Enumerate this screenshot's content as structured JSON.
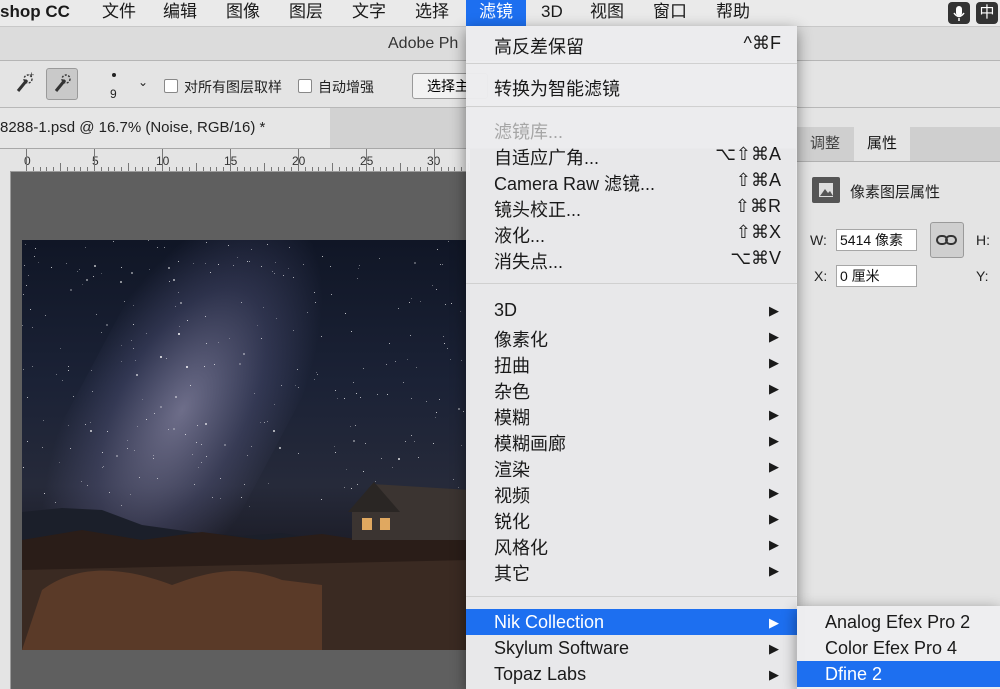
{
  "menubar": {
    "app": "shop CC",
    "items": [
      "文件",
      "编辑",
      "图像",
      "图层",
      "文字",
      "选择",
      "滤镜",
      "3D",
      "视图",
      "窗口",
      "帮助"
    ],
    "active_index": 6,
    "input_method": "中"
  },
  "window": {
    "title": "Adobe Ph"
  },
  "options_bar": {
    "brush_size": "9",
    "sample_all_layers": "对所有图层取样",
    "auto_enhance": "自动增强",
    "select_subject": "选择主"
  },
  "document_tab": {
    "label": "8288-1.psd @ 16.7% (Noise, RGB/16) *"
  },
  "ruler": {
    "labels": [
      "0",
      "5",
      "10",
      "15",
      "20",
      "25",
      "30"
    ]
  },
  "panel": {
    "tabs": [
      "调整",
      "属性"
    ],
    "selected_tab": 1,
    "title": "像素图层属性",
    "w_label": "W:",
    "w_value": "5414 像素",
    "h_label": "H:",
    "x_label": "X:",
    "x_value": "0 厘米",
    "y_label": "Y:"
  },
  "filter_menu": {
    "items": [
      {
        "label": "高反差保留",
        "shortcut": "^⌘F"
      },
      {
        "label": "转换为智能滤镜",
        "shortcut": ""
      },
      {
        "label": "滤镜库...",
        "shortcut": "",
        "disabled": true
      },
      {
        "label": "自适应广角...",
        "shortcut": "⌥⇧⌘A"
      },
      {
        "label": "Camera Raw 滤镜...",
        "shortcut": "⇧⌘A"
      },
      {
        "label": "镜头校正...",
        "shortcut": "⇧⌘R"
      },
      {
        "label": "液化...",
        "shortcut": "⇧⌘X"
      },
      {
        "label": "消失点...",
        "shortcut": "⌥⌘V"
      },
      {
        "label": "3D",
        "submenu": true
      },
      {
        "label": "像素化",
        "submenu": true
      },
      {
        "label": "扭曲",
        "submenu": true
      },
      {
        "label": "杂色",
        "submenu": true
      },
      {
        "label": "模糊",
        "submenu": true
      },
      {
        "label": "模糊画廊",
        "submenu": true
      },
      {
        "label": "渲染",
        "submenu": true
      },
      {
        "label": "视频",
        "submenu": true
      },
      {
        "label": "锐化",
        "submenu": true
      },
      {
        "label": "风格化",
        "submenu": true
      },
      {
        "label": "其它",
        "submenu": true
      },
      {
        "label": "Nik Collection",
        "submenu": true,
        "highlighted": true
      },
      {
        "label": "Skylum Software",
        "submenu": true
      },
      {
        "label": "Topaz Labs",
        "submenu": true
      }
    ]
  },
  "nik_submenu": {
    "items": [
      "Analog Efex Pro 2",
      "Color Efex Pro 4",
      "Dfine 2"
    ],
    "highlighted_index": 2
  },
  "colors": {
    "accent": "#1d6ff0"
  }
}
